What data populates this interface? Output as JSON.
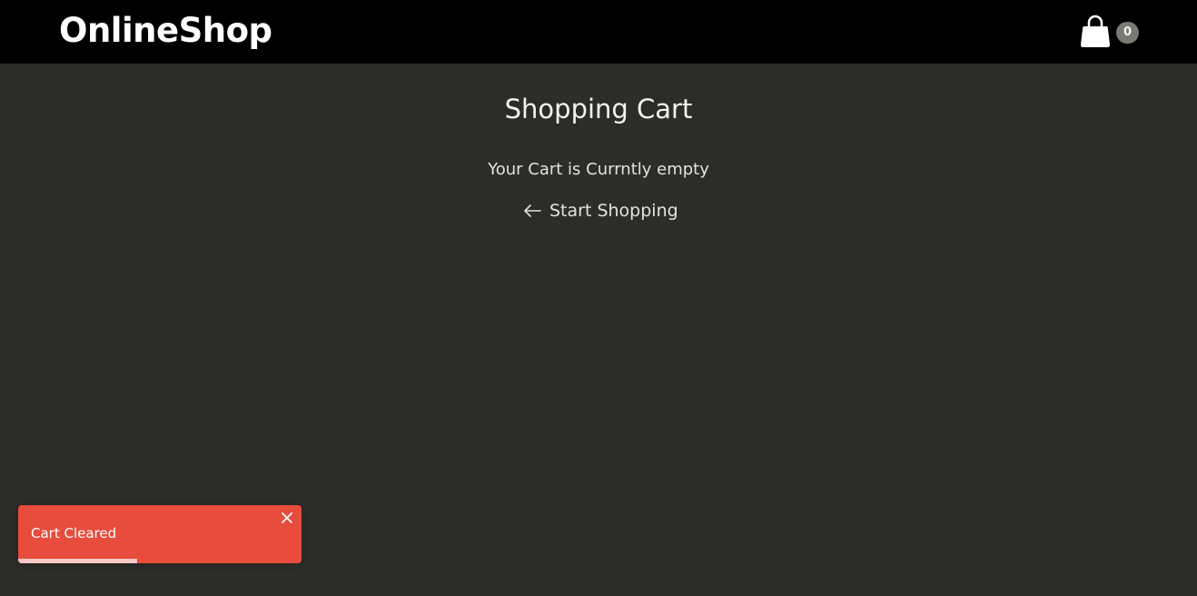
{
  "header": {
    "brand": "OnlineShop",
    "cart_icon": "shopping-bag-icon",
    "cart_count": "0"
  },
  "main": {
    "title": "Shopping Cart",
    "empty_message": "Your Cart is Currntly empty",
    "start_shopping_icon": "arrow-left-icon",
    "start_shopping_label": "Start Shopping"
  },
  "toast": {
    "message": "Cart Cleared",
    "close_icon": "close-icon",
    "progress_remaining": 0.42,
    "color": "#e74c3c"
  },
  "colors": {
    "header_bg": "#000000",
    "page_bg": "#2c2c28",
    "badge_bg": "#7a7a72"
  }
}
